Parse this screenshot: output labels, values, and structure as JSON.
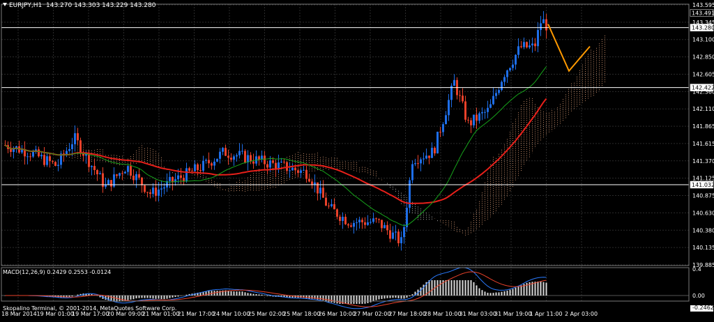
{
  "chart": {
    "symbol": "EURJPY,H1",
    "ohlc": "143.270 143.303 143.229 143.280",
    "price_axis_labels": [
      "143.595",
      "143.345",
      "143.100",
      "142.850",
      "142.605",
      "142.360",
      "142.110",
      "141.865",
      "141.615",
      "141.370",
      "141.125",
      "140.875",
      "140.630",
      "140.380",
      "140.135",
      "139.885"
    ],
    "price_highlights": [
      {
        "value": "143.491",
        "bg": "#000000",
        "fg": "#ffffff"
      },
      {
        "value": "143.280",
        "bg": "#ffffff",
        "fg": "#000000"
      },
      {
        "value": "142.422",
        "bg": "#ffffff",
        "fg": "#000000"
      },
      {
        "value": "141.032",
        "bg": "#ffffff",
        "fg": "#000000"
      }
    ],
    "time_axis_labels": [
      "18 Mar 2014",
      "19 Mar 01:00",
      "19 Mar 17:00",
      "20 Mar 09:00",
      "21 Mar 01:00",
      "21 Mar 17:00",
      "24 Mar 10:00",
      "25 Mar 02:00",
      "25 Mar 18:00",
      "26 Mar 10:00",
      "27 Mar 02:00",
      "27 Mar 18:00",
      "28 Mar 10:00",
      "31 Mar 03:00",
      "31 Mar 19:00",
      "1 Apr 11:00",
      "2 Apr 03:00"
    ],
    "colors": {
      "background": "#000000",
      "grid": "#2b2b2b",
      "bull": "#1e6ee8",
      "bear": "#e8412a",
      "ma_red": "#e8201a",
      "ma_green": "#17a51b",
      "cloud_bull": "#e3a27a",
      "cloud_bear": "#c9c9c9",
      "forecast": "#ff9900",
      "hline": "#ffffff"
    }
  },
  "macd": {
    "header": "MACD(12,26,9) 0.2429 0.2553 -0.0124",
    "axis_labels": [
      "0.4",
      "0.00",
      "-0.2462"
    ]
  },
  "footer": {
    "copyright": "Skopalino Terminal, © 2001-2014, MetaQuotes Software Corp."
  }
}
